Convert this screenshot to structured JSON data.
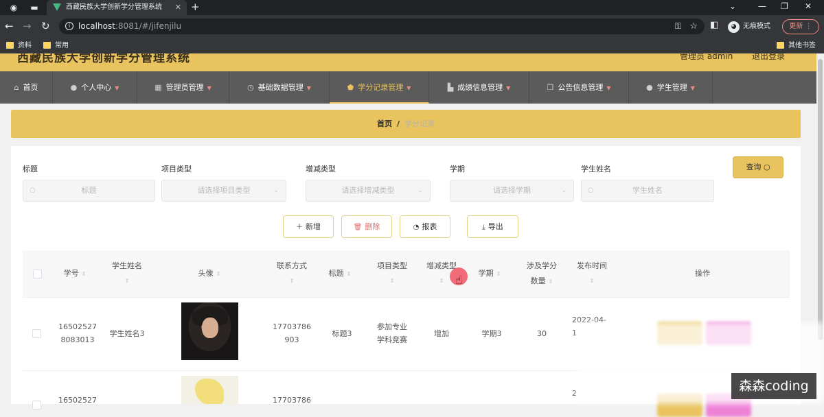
{
  "browser": {
    "tab_title": "西藏民族大学创新学分管理系统",
    "url_host": "localhost",
    "url_rest": ":8081/#/jifenjilu",
    "incognito_label": "无痕模式",
    "update_label": "更新",
    "bookmarks": [
      "资料",
      "常用"
    ],
    "other_bookmarks": "其他书签"
  },
  "site": {
    "title": "西藏民族大学创新学分管理系统",
    "user": "管理员 admin",
    "logout": "退出登录"
  },
  "nav": [
    {
      "label": "首页",
      "icon": "home-icon"
    },
    {
      "label": "个人中心",
      "icon": "user-icon"
    },
    {
      "label": "管理员管理",
      "icon": "grid-icon"
    },
    {
      "label": "基础数据管理",
      "icon": "clock-icon"
    },
    {
      "label": "学分记录管理",
      "icon": "shield-icon",
      "active": true
    },
    {
      "label": "成绩信息管理",
      "icon": "factory-icon"
    },
    {
      "label": "公告信息管理",
      "icon": "copy-icon"
    },
    {
      "label": "学生管理",
      "icon": "user-icon"
    }
  ],
  "breadcrumb": {
    "home": "首页",
    "separator": "/",
    "current": "学分记录"
  },
  "filters": {
    "title": {
      "label": "标题",
      "placeholder": "标题"
    },
    "project_type": {
      "label": "项目类型",
      "placeholder": "请选择项目类型"
    },
    "change_type": {
      "label": "增减类型",
      "placeholder": "请选择增减类型"
    },
    "semester": {
      "label": "学期",
      "placeholder": "请选择学期"
    },
    "student_name": {
      "label": "学生姓名",
      "placeholder": "学生姓名"
    },
    "query_label": "查询"
  },
  "actions": {
    "add": "新增",
    "delete": "删除",
    "report": "报表",
    "export": "导出"
  },
  "table": {
    "headers": {
      "student_no": "学号",
      "student_name": "学生姓名",
      "avatar": "头像",
      "contact": "联系方式",
      "title": "标题",
      "project_type": "项目类型",
      "change_type": "增减类型",
      "semester": "学期",
      "credits_1": "涉及学分",
      "credits_2": "数量",
      "publish_time": "发布时间",
      "operations": "操作"
    },
    "rows": [
      {
        "student_no_1": "16502527",
        "student_no_2": "8083013",
        "student_name": "学生姓名3",
        "contact_1": "17703786",
        "contact_2": "903",
        "title": "标题3",
        "project_type_1": "参加专业",
        "project_type_2": "学科竞赛",
        "change_type": "增加",
        "semester": "学期3",
        "credits": "30",
        "publish_time_1": "2022-04-",
        "publish_time_2": "1"
      },
      {
        "student_no_1": "16502527",
        "contact_1": "17703786",
        "publish_time_1": "2"
      }
    ]
  },
  "watermark": "森森coding"
}
